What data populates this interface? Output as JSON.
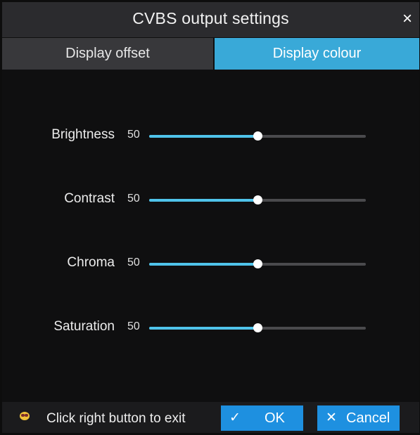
{
  "dialog": {
    "title": "CVBS output settings",
    "close_glyph": "×"
  },
  "tabs": [
    {
      "label": "Display offset",
      "active": false
    },
    {
      "label": "Display colour",
      "active": true
    }
  ],
  "sliders": [
    {
      "label": "Brightness",
      "value": "50",
      "level": 0.5
    },
    {
      "label": "Contrast",
      "value": "50",
      "level": 0.5
    },
    {
      "label": "Chroma",
      "value": "50",
      "level": 0.5
    },
    {
      "label": "Saturation",
      "value": "50",
      "level": 0.5
    }
  ],
  "footer": {
    "hint_icon": "mouse-smiley-icon",
    "hint_text": "Click right button to exit",
    "ok_label": "OK",
    "ok_icon": "checkmark-icon",
    "ok_glyph": "✓",
    "cancel_label": "Cancel",
    "cancel_icon": "x-icon",
    "cancel_glyph": "✕"
  },
  "colors": {
    "accent": "#39a9d8",
    "slider_fill": "#4fc3ea",
    "button": "#1e90e0",
    "background": "#0f0f10"
  }
}
